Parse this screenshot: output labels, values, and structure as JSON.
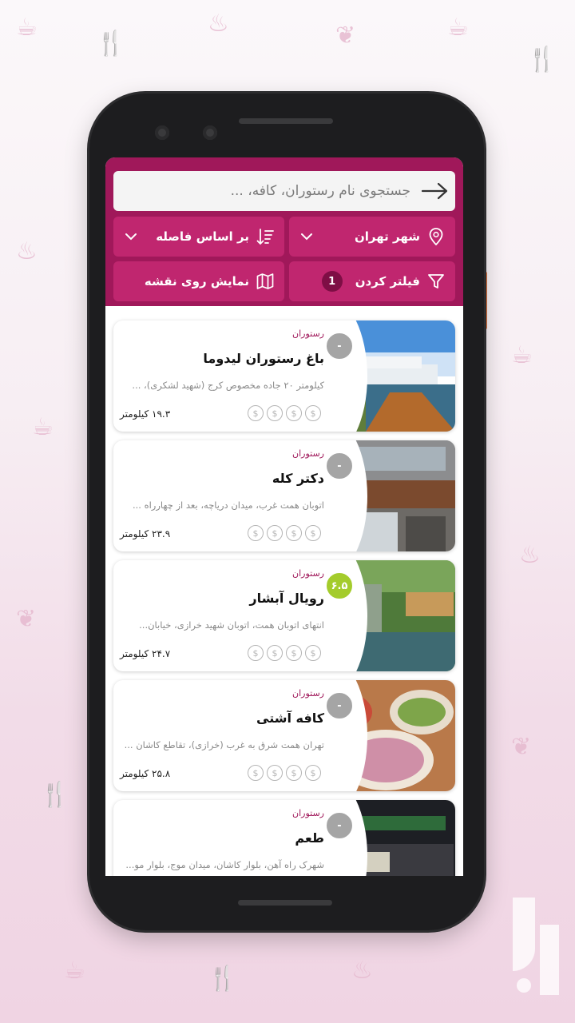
{
  "search": {
    "placeholder": "جستجوی نام رستوران، کافه، ..."
  },
  "filters": {
    "city": "شهر تهران",
    "sort": "بر اساس فاصله",
    "filter": "فیلتر کردن",
    "filter_count": "1",
    "map": "نمایش روی نقشه"
  },
  "restaurants": [
    {
      "category": "رستوران",
      "name": "باغ رستوران لیدوما",
      "address": "کیلومتر ۲۰ جاده مخصوص کرج (شهید لشکری)، ...",
      "distance": "۱۹.۳ کیلومتر",
      "rating": "-",
      "price_level": 0,
      "price_max": 4
    },
    {
      "category": "رستوران",
      "name": "دکتر کله",
      "address": "اتوبان همت غرب، میدان دریاچه، بعد از چهارراه ...",
      "distance": "۲۳.۹ کیلومتر",
      "rating": "-",
      "price_level": 0,
      "price_max": 4
    },
    {
      "category": "رستوران",
      "name": "رویال آبشار",
      "address": "انتهای اتوبان همت، اتوبان شهید خرازی، خیابان...",
      "distance": "۲۴.۷ کیلومتر",
      "rating": "۶.۵",
      "price_level": 0,
      "price_max": 4
    },
    {
      "category": "رستوران",
      "name": "کافه آشتی",
      "address": "تهران همت شرق به غرب (خرازی)، تقاطع کاشان ...",
      "distance": "۲۵.۸ کیلومتر",
      "rating": "-",
      "price_level": 0,
      "price_max": 4
    },
    {
      "category": "رستوران",
      "name": "طعم",
      "address": "شهرک راه آهن، بلوار کاشان، میدان موج، بلوار مو...",
      "distance": "",
      "rating": "-",
      "price_level": 0,
      "price_max": 4
    }
  ],
  "price_symbol": "$",
  "colors": {
    "brand": "#a0185a",
    "button": "#c0266f",
    "rating_green": "#a4cc2c",
    "rating_gray": "#a5a5a5"
  },
  "icons": [
    "back-arrow-icon",
    "location-pin-icon",
    "chevron-down-icon",
    "sort-icon",
    "filter-icon",
    "map-icon"
  ]
}
